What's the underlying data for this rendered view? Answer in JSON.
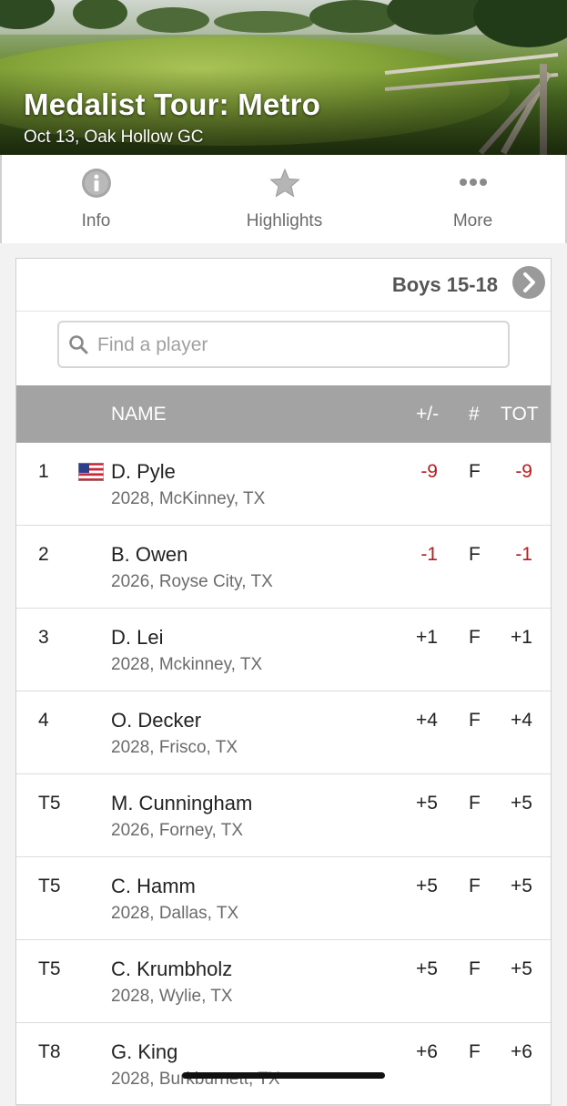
{
  "event": {
    "title": "Medalist Tour: Metro",
    "subtitle": "Oct 13, Oak Hollow GC"
  },
  "tabs": [
    {
      "label": "Info",
      "icon": "info-icon"
    },
    {
      "label": "Highlights",
      "icon": "star-icon"
    },
    {
      "label": "More",
      "icon": "more-dots-icon"
    }
  ],
  "division": {
    "label": "Boys 15-18"
  },
  "search": {
    "placeholder": "Find a player",
    "value": ""
  },
  "table": {
    "headers": {
      "name": "NAME",
      "to_par": "+/-",
      "thru": "#",
      "total": "TOT"
    },
    "rows": [
      {
        "pos": "1",
        "name": "D. Pyle",
        "info": "2028, McKinney, TX",
        "to_par": "-9",
        "thru": "F",
        "total": "-9",
        "flag": "us-flag-icon",
        "under_par": true
      },
      {
        "pos": "2",
        "name": "B. Owen",
        "info": "2026, Royse City, TX",
        "to_par": "-1",
        "thru": "F",
        "total": "-1",
        "under_par": true
      },
      {
        "pos": "3",
        "name": "D. Lei",
        "info": "2028, Mckinney, TX",
        "to_par": "+1",
        "thru": "F",
        "total": "+1"
      },
      {
        "pos": "4",
        "name": "O. Decker",
        "info": "2028, Frisco, TX",
        "to_par": "+4",
        "thru": "F",
        "total": "+4"
      },
      {
        "pos": "T5",
        "name": "M. Cunningham",
        "info": "2026, Forney, TX",
        "to_par": "+5",
        "thru": "F",
        "total": "+5"
      },
      {
        "pos": "T5",
        "name": "C. Hamm",
        "info": "2028, Dallas, TX",
        "to_par": "+5",
        "thru": "F",
        "total": "+5"
      },
      {
        "pos": "T5",
        "name": "C. Krumbholz",
        "info": "2028, Wylie, TX",
        "to_par": "+5",
        "thru": "F",
        "total": "+5"
      },
      {
        "pos": "T8",
        "name": "G. King",
        "info": "2028, Burkburnett, TX",
        "to_par": "+6",
        "thru": "F",
        "total": "+6"
      }
    ]
  },
  "colors": {
    "under_par": "#c0191b",
    "header_bg": "#a3a3a3",
    "text": "#222222",
    "muted": "#6b6b6b"
  }
}
